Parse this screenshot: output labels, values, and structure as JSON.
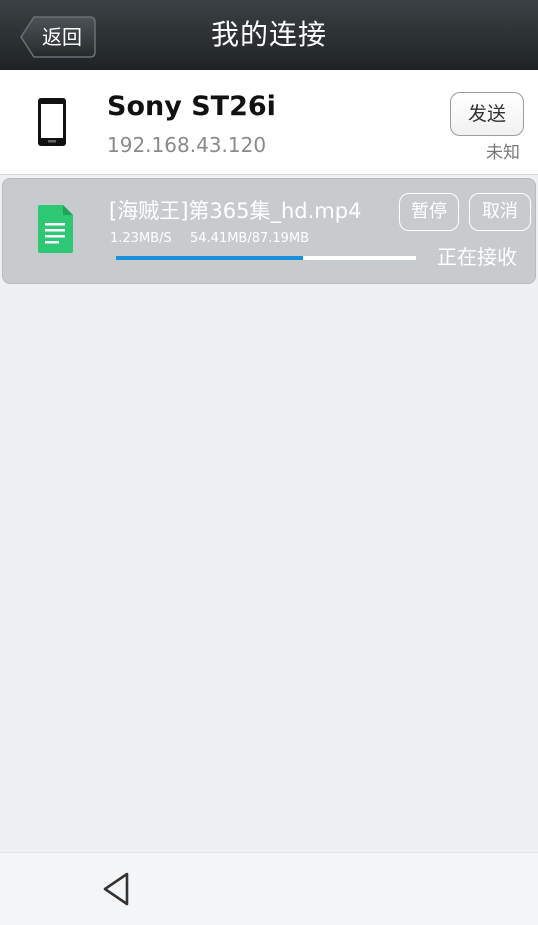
{
  "header": {
    "title": "我的连接",
    "back_label": "返回"
  },
  "device": {
    "name": "Sony ST26i",
    "ip": "192.168.43.120",
    "send_label": "发送",
    "status": "未知",
    "icon": "phone-icon"
  },
  "transfer": {
    "file_name": "[海贼王]第365集_hd.mp4",
    "speed": "1.23MB/S",
    "size": "54.41MB/87.19MB",
    "progress_fraction": 0.624,
    "pause_label": "暂停",
    "cancel_label": "取消",
    "status": "正在接收",
    "icon": "document-icon"
  },
  "nav": {
    "back_icon": "triangle-back-icon"
  },
  "colors": {
    "accent": "#1a90da",
    "file_icon": "#2ec774",
    "header_bg": "#2b3033",
    "card_bg": "#c7cbce"
  }
}
